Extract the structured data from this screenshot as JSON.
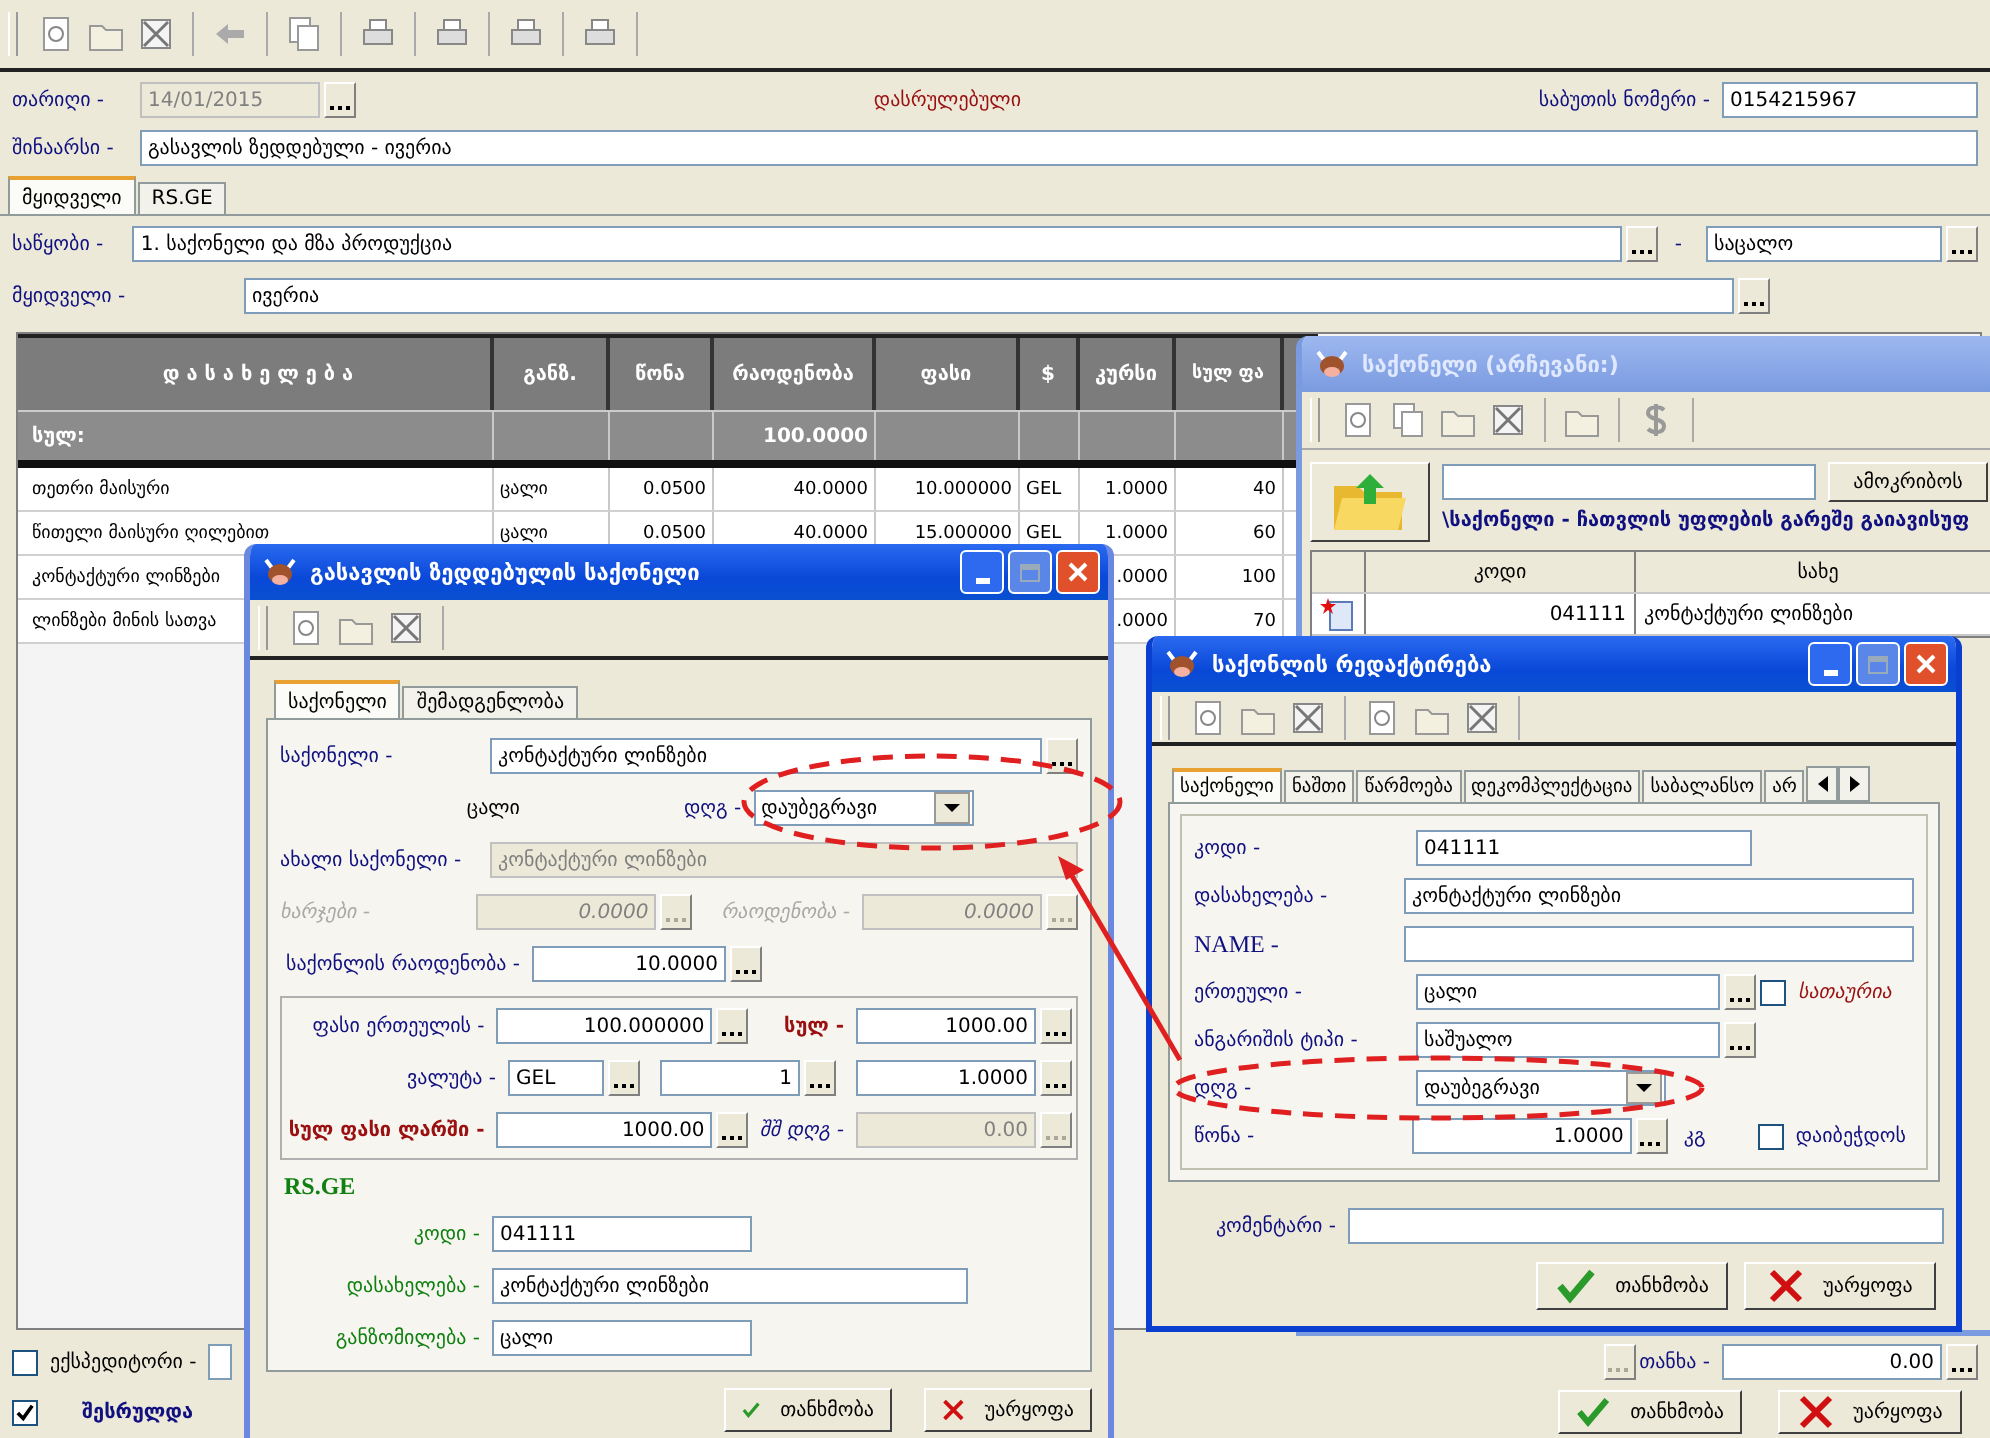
{
  "document": {
    "date_label": "თარიღი -",
    "date": "14/01/2015",
    "date_disabled": true,
    "status": "დასრულებული",
    "number_label": "საბუთის ნომერი -",
    "number": "0154215967",
    "content_label": "შინაარსი -",
    "content": "გასავლის ზედდებული - ივერია"
  },
  "tabs": [
    {
      "label": "მყიდველი",
      "selected": true
    },
    {
      "label": "RS.GE",
      "selected": false
    }
  ],
  "warehouse": {
    "label": "საწყობი -",
    "value": "1. საქონელი და მზა პროდუქცია",
    "separator": "-",
    "price_type": "საცალო"
  },
  "buyer": {
    "label": "მყიდველი -",
    "value": "ივერია"
  },
  "table": {
    "columns": [
      "დ ა ს ა ხ ე ლ ე ბ ა",
      "განზ.",
      "წონა",
      "რაოდენობა",
      "ფასი",
      "$",
      "კურსი",
      "სულ ფა"
    ],
    "total": {
      "label": "სულ:",
      "qty": "100.0000"
    },
    "rows": [
      {
        "name": "თეთრი მაისური",
        "unit": "ცალი",
        "weight": "0.0500",
        "qty": "40.0000",
        "price": "10.000000",
        "cur": "GEL",
        "rate": "1.0000",
        "sum": "40"
      },
      {
        "name": "წითელი მაისური ღილებით",
        "unit": "ცალი",
        "weight": "0.0500",
        "qty": "40.0000",
        "price": "15.000000",
        "cur": "GEL",
        "rate": "1.0000",
        "sum": "60"
      },
      {
        "name": "კონტაქტური ლინზები",
        "rate": ".0000",
        "sum": "100"
      },
      {
        "name": "ლინზები მინის სათვა",
        "rate": ".0000",
        "sum": "70"
      }
    ]
  },
  "footer": {
    "forwarder": {
      "label": "ექსპედიტორი -",
      "checked": false
    },
    "amount_label": "თანხა -",
    "amount": "0.00",
    "done": {
      "label": "შესრულდა",
      "checked": true
    },
    "buttons": [
      {
        "label": "თანხმობა",
        "kind": "ok"
      },
      {
        "label": "უარყოფა",
        "kind": "cancel"
      }
    ]
  },
  "picker_window": {
    "title": "საქონელი (არჩევანი:)",
    "search_button": "ამოკრიბოს",
    "path": "\\საქონელი - ჩათვლის უფლების გარეშე გაიავისუფ",
    "columns": [
      "კოდი",
      "სახე"
    ],
    "rows": [
      {
        "code": "041111",
        "name": "კონტაქტური ლინზები"
      }
    ]
  },
  "item_dialog": {
    "title": "გასავლის ზედდებულის საქონელი",
    "tabs": [
      {
        "label": "საქონელი",
        "selected": true
      },
      {
        "label": "შემადგენლობა",
        "selected": false
      }
    ],
    "goods": {
      "label": "საქონელი -",
      "value": "კონტაქტური ლინზები"
    },
    "unit": "ცალი",
    "vat": {
      "label": "დღგ -",
      "value": "დაუბეგრავი"
    },
    "new_goods": {
      "label": "ახალი საქონელი -",
      "value": "კონტაქტური ლინზები",
      "disabled": true
    },
    "expenses": {
      "label": "ხარჯები -",
      "value": "0.0000",
      "disabled": true
    },
    "quantity2": {
      "label": "რაოდენობა -",
      "value": "0.0000",
      "disabled": true
    },
    "quantity": {
      "label": "საქონლის რაოდენობა -",
      "value": "10.0000"
    },
    "unit_price": {
      "label": "ფასი ერთეულის -",
      "value": "100.000000"
    },
    "sum": {
      "label": "სულ -",
      "value": "1000.00"
    },
    "currency": {
      "label": "ვალუტა -",
      "code": "GEL",
      "factor": "1",
      "rate": "1.0000"
    },
    "total_gel": {
      "label": "სულ ფასი ლარში -",
      "value": "1000.00"
    },
    "incl_vat": {
      "label": "შშ დღგ -",
      "value": "0.00",
      "disabled": true
    },
    "rs_title": "RS.GE",
    "rs_fields": [
      {
        "label": "კოდი -",
        "value": "041111",
        "wide": false
      },
      {
        "label": "დასახელება -",
        "value": "კონტაქტური ლინზები",
        "wide": true
      },
      {
        "label": "განზომილება -",
        "value": "ცალი",
        "wide": false
      }
    ],
    "buttons": [
      {
        "label": "თანხმობა",
        "kind": "ok"
      },
      {
        "label": "უარყოფა",
        "kind": "cancel"
      }
    ]
  },
  "edit_dialog": {
    "title": "საქონლის რედაქტირება",
    "tabs": [
      {
        "label": "საქონელი",
        "selected": true
      },
      {
        "label": "ნაშთი",
        "selected": false
      },
      {
        "label": "წარმოება",
        "selected": false
      },
      {
        "label": "დეკომპლექტაცია",
        "selected": false
      },
      {
        "label": "საბალანსო",
        "selected": false
      },
      {
        "label": "არ",
        "selected": false
      }
    ],
    "code": {
      "label": "კოდი -",
      "value": "041111"
    },
    "name": {
      "label": "დასახელება -",
      "value": "კონტაქტური ლინზები"
    },
    "name_en": {
      "label": "NAME -"
    },
    "unit": {
      "label": "ერთეული -",
      "value": "ცალი",
      "check_label": "სათაურია",
      "checked": false
    },
    "account_type": {
      "label": "ანგარიშის ტიპი -",
      "value": "საშუალო"
    },
    "vat": {
      "label": "დღგ -",
      "value": "დაუბეგრავი"
    },
    "weight": {
      "label": "წონა -",
      "value": "1.0000",
      "unit": "კგ",
      "check_label": "დაიბეჭდოს",
      "checked": false
    },
    "comment": {
      "label": "კომენტარი -"
    },
    "buttons": [
      {
        "label": "თანხმობა",
        "kind": "ok"
      },
      {
        "label": "უარყოფა",
        "kind": "cancel"
      }
    ]
  }
}
